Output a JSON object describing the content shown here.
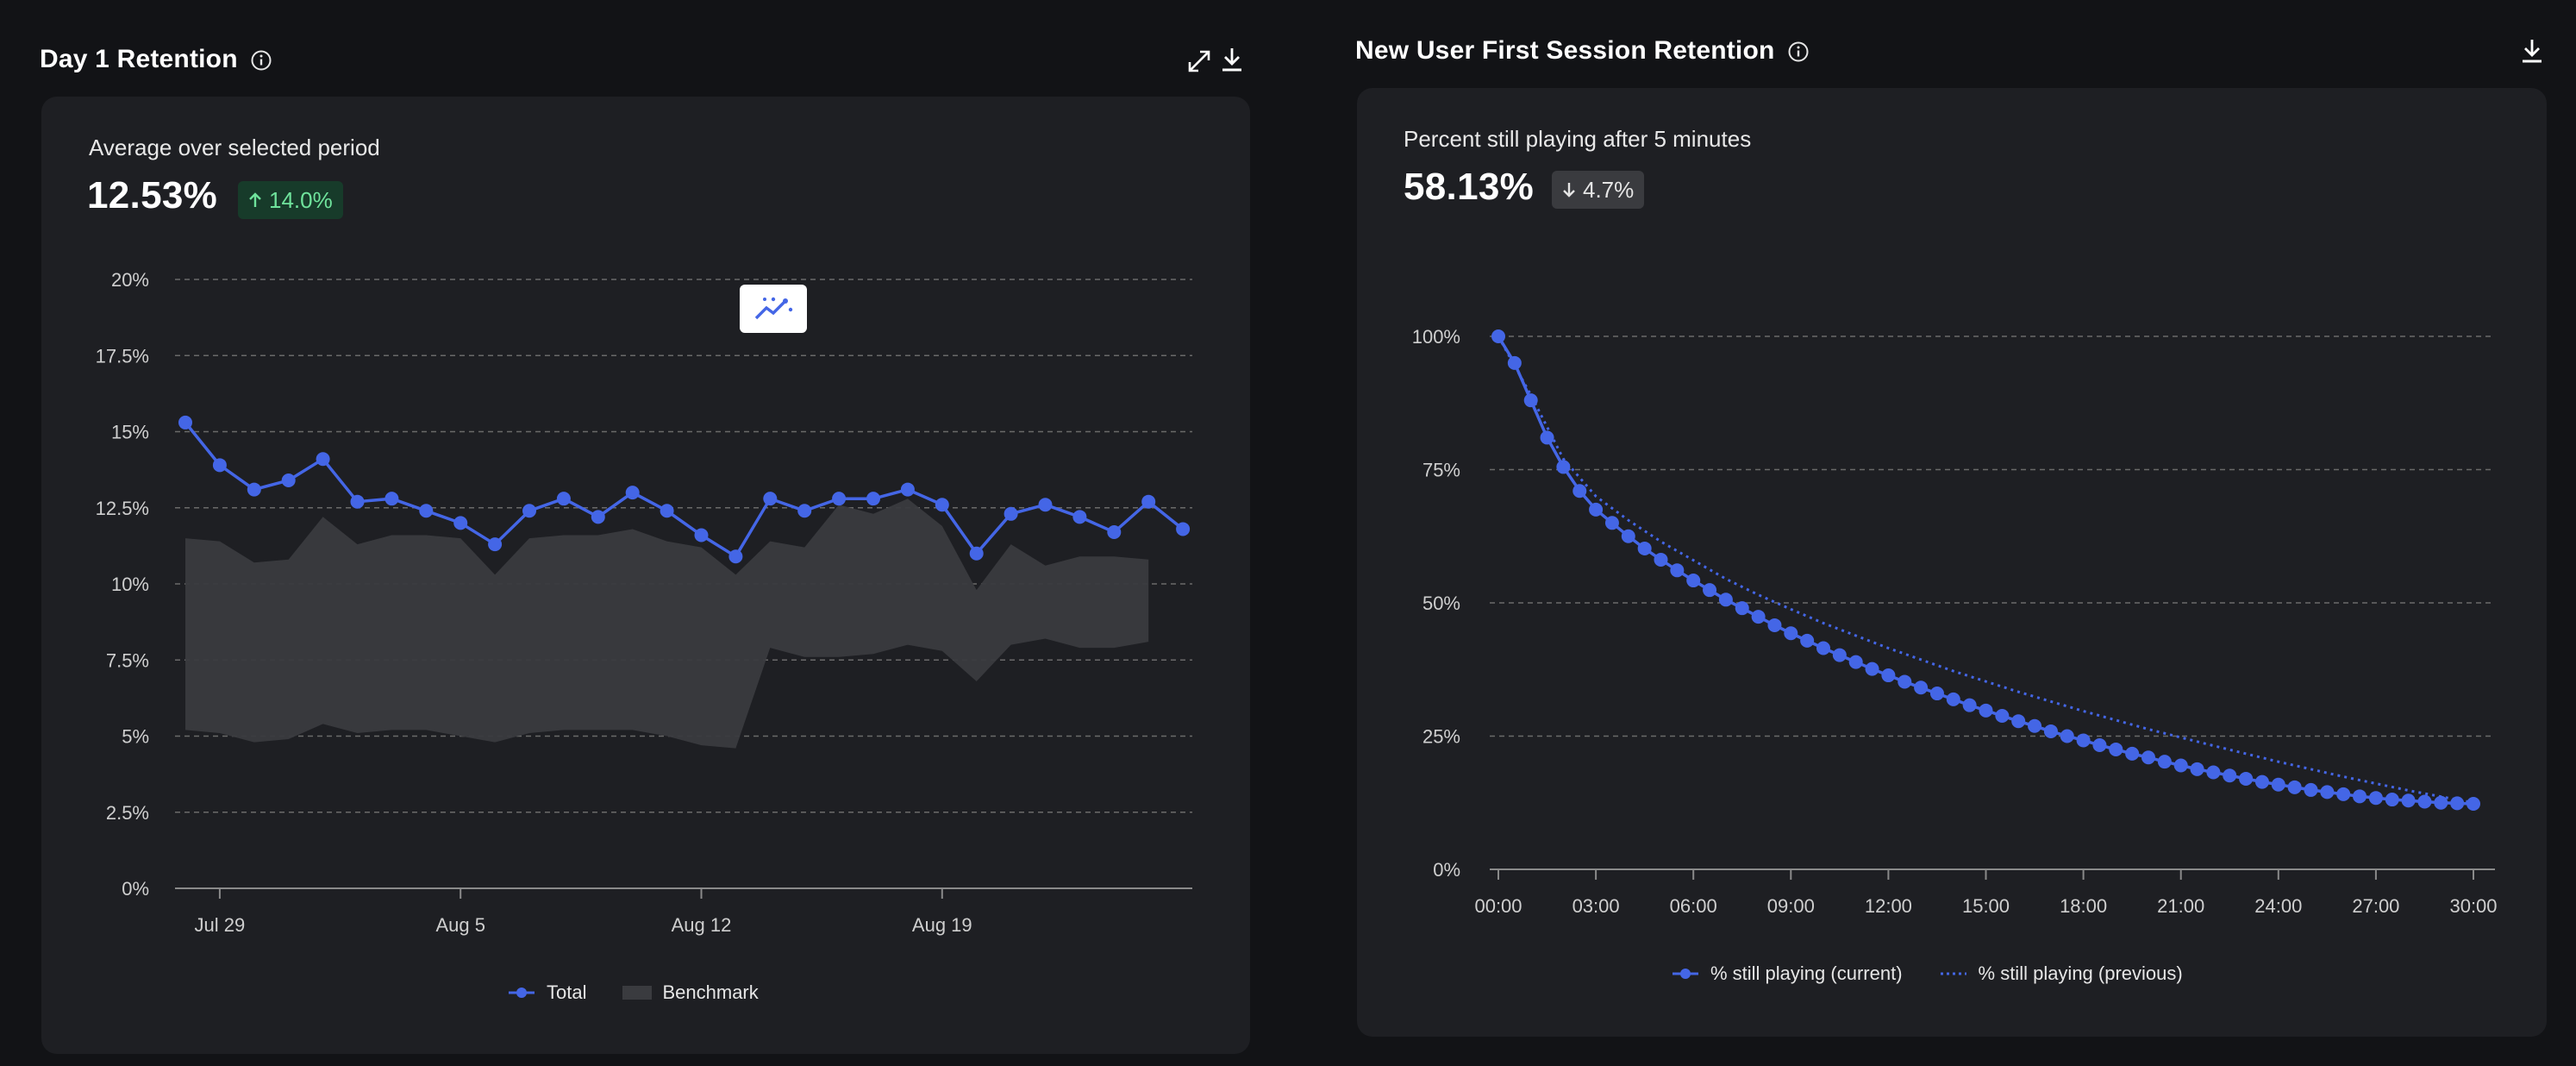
{
  "left_panel": {
    "title": "Day 1 Retention",
    "subtitle": "Average over selected period",
    "value": "12.53%",
    "change": "14.0%",
    "change_direction": "up",
    "icons": [
      "info-icon",
      "expand-icon",
      "download-icon",
      "anomaly-chart-icon"
    ],
    "legend": {
      "total": "Total",
      "benchmark": "Benchmark"
    }
  },
  "right_panel": {
    "title": "New User First Session Retention",
    "subtitle": "Percent still playing after 5 minutes",
    "value": "58.13%",
    "change": "4.7%",
    "change_direction": "down",
    "icons": [
      "info-icon",
      "download-icon"
    ],
    "legend": {
      "current": "% still playing (current)",
      "previous": "% still playing (previous)"
    }
  },
  "colors": {
    "accent": "#4466e6",
    "benchmark": "#3a3b3f",
    "up": "#6fe39c"
  },
  "chart_data": [
    {
      "type": "line",
      "y_ticks": [
        "0%",
        "2.5%",
        "5%",
        "7.5%",
        "10%",
        "12.5%",
        "15%",
        "17.5%",
        "20%"
      ],
      "ylim": [
        0,
        20
      ],
      "x_ticks": [
        {
          "label": "Jul 29",
          "index": 1
        },
        {
          "label": "Aug 5",
          "index": 8
        },
        {
          "label": "Aug 12",
          "index": 15
        },
        {
          "label": "Aug 19",
          "index": 22
        }
      ],
      "x_count": 30,
      "series": [
        {
          "name": "Total",
          "values": [
            15.3,
            13.9,
            13.1,
            13.4,
            14.1,
            12.7,
            12.8,
            12.4,
            12.0,
            11.3,
            12.4,
            12.8,
            12.2,
            13.0,
            12.4,
            11.6,
            10.9,
            12.8,
            12.4,
            12.8,
            12.8,
            13.1,
            12.6,
            11.0,
            12.3,
            12.6,
            12.2,
            11.7,
            12.7,
            11.8
          ]
        }
      ],
      "benchmark": {
        "name": "Benchmark",
        "upper": [
          11.5,
          11.4,
          10.7,
          10.8,
          12.2,
          11.3,
          11.6,
          11.6,
          11.5,
          10.3,
          11.5,
          11.6,
          11.6,
          11.8,
          11.4,
          11.2,
          10.3,
          11.4,
          11.2,
          12.6,
          12.3,
          12.8,
          11.9,
          9.8,
          11.3,
          10.6,
          10.9,
          10.9,
          10.8
        ],
        "lower": [
          5.2,
          5.1,
          4.8,
          4.9,
          5.4,
          5.1,
          5.2,
          5.2,
          5.0,
          4.8,
          5.1,
          5.2,
          5.2,
          5.2,
          5.0,
          4.7,
          4.6,
          7.9,
          7.6,
          7.6,
          7.7,
          8.0,
          7.8,
          6.8,
          8.0,
          8.2,
          7.9,
          7.9,
          8.1
        ]
      }
    },
    {
      "type": "line",
      "y_ticks": [
        "0%",
        "25%",
        "50%",
        "75%",
        "100%"
      ],
      "ylim": [
        0,
        100
      ],
      "x_ticks": [
        "00:00",
        "03:00",
        "06:00",
        "09:00",
        "12:00",
        "15:00",
        "18:00",
        "21:00",
        "24:00",
        "27:00",
        "30:00"
      ],
      "xlim_minutes": [
        0,
        30
      ],
      "series": [
        {
          "name": "% still playing (current)",
          "style": "solid-with-markers",
          "x_minutes": [
            0,
            0.5,
            1,
            1.5,
            2,
            2.5,
            3,
            3.5,
            4,
            4.5,
            5,
            5.5,
            6,
            6.5,
            7,
            7.5,
            8,
            8.5,
            9,
            9.5,
            10,
            10.5,
            11,
            11.5,
            12,
            12.5,
            13,
            13.5,
            14,
            14.5,
            15,
            15.5,
            16,
            16.5,
            17,
            17.5,
            18,
            18.5,
            19,
            19.5,
            20,
            20.5,
            21,
            21.5,
            22,
            22.5,
            23,
            23.5,
            24,
            24.5,
            25,
            25.5,
            26,
            26.5,
            27,
            27.5,
            28,
            28.5,
            29,
            29.5,
            30
          ],
          "values": [
            100,
            95,
            88,
            81,
            75.5,
            71,
            67.5,
            65,
            62.5,
            60.2,
            58.1,
            56.1,
            54.2,
            52.4,
            50.6,
            49.0,
            47.4,
            45.8,
            44.3,
            42.9,
            41.5,
            40.2,
            38.9,
            37.6,
            36.4,
            35.2,
            34.1,
            33.0,
            31.9,
            30.8,
            29.8,
            28.8,
            27.8,
            26.9,
            25.9,
            25.0,
            24.2,
            23.3,
            22.5,
            21.7,
            21.0,
            20.2,
            19.5,
            18.8,
            18.2,
            17.6,
            17.0,
            16.4,
            15.9,
            15.4,
            14.9,
            14.5,
            14.1,
            13.7,
            13.4,
            13.1,
            12.9,
            12.7,
            12.5,
            12.4,
            12.3
          ]
        },
        {
          "name": "% still playing (previous)",
          "style": "dotted",
          "x_minutes": [
            0,
            1,
            2,
            3,
            4,
            5,
            6,
            7,
            8,
            9,
            10,
            12,
            14,
            16,
            18,
            20,
            22,
            24,
            26,
            28,
            30
          ],
          "values": [
            100,
            89,
            77,
            70,
            65.5,
            61.5,
            58,
            54.5,
            51.5,
            48.8,
            46.2,
            41.5,
            37.2,
            33.3,
            29.7,
            26.3,
            23.2,
            20.2,
            17.4,
            14.8,
            12.5
          ]
        }
      ]
    }
  ]
}
